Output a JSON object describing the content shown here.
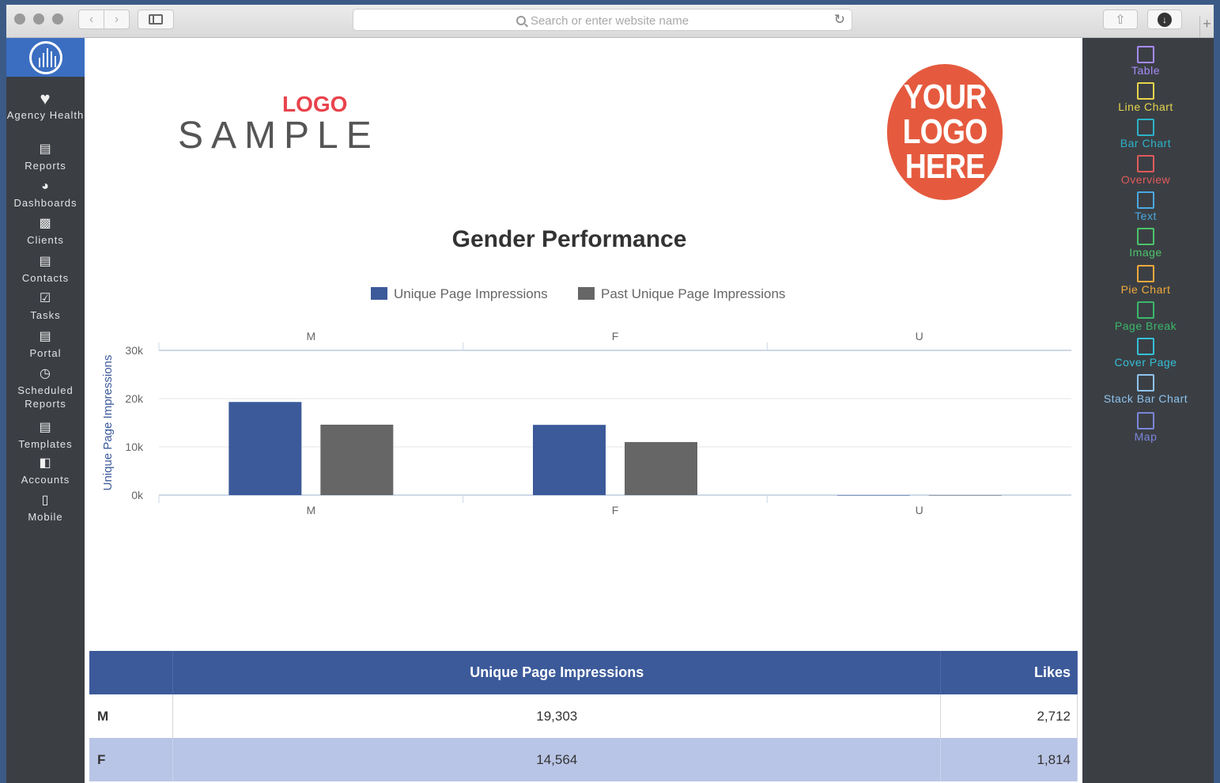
{
  "browser": {
    "url_placeholder": "Search or enter website name"
  },
  "left_nav": {
    "items": [
      {
        "label": "Agency Health",
        "icon": "heart-icon"
      },
      {
        "label": "Reports",
        "icon": "reports-icon"
      },
      {
        "label": "Dashboards",
        "icon": "pie-icon"
      },
      {
        "label": "Clients",
        "icon": "briefcase-icon"
      },
      {
        "label": "Contacts",
        "icon": "contacts-icon"
      },
      {
        "label": "Tasks",
        "icon": "checkbox-icon"
      },
      {
        "label": "Portal",
        "icon": "portal-icon"
      },
      {
        "label": "Scheduled Reports",
        "icon": "clock-icon"
      },
      {
        "label": "Templates",
        "icon": "templates-icon"
      },
      {
        "label": "Accounts",
        "icon": "accounts-icon"
      },
      {
        "label": "Mobile",
        "icon": "mobile-icon"
      }
    ]
  },
  "right_tools": {
    "items": [
      {
        "label": "Table",
        "color": "#a78bfa",
        "icon": "table-icon"
      },
      {
        "label": "Line Chart",
        "color": "#e8d44d",
        "icon": "line-chart-icon"
      },
      {
        "label": "Bar Chart",
        "color": "#2bb3c9",
        "icon": "bar-chart-icon"
      },
      {
        "label": "Overview",
        "color": "#e05a5a",
        "icon": "overview-icon"
      },
      {
        "label": "Text",
        "color": "#4aa8e0",
        "icon": "text-icon"
      },
      {
        "label": "Image",
        "color": "#4cc46b",
        "icon": "image-icon"
      },
      {
        "label": "Pie Chart",
        "color": "#f2a93b",
        "icon": "pie-chart-icon"
      },
      {
        "label": "Page Break",
        "color": "#3bb86a",
        "icon": "page-break-icon"
      },
      {
        "label": "Cover Page",
        "color": "#35c0d8",
        "icon": "cover-page-icon"
      },
      {
        "label": "Stack Bar Chart",
        "color": "#8fc3ee",
        "icon": "stack-bar-chart-icon"
      },
      {
        "label": "Map",
        "color": "#7b86d9",
        "icon": "map-icon"
      }
    ]
  },
  "report": {
    "logo_small": "LOGO",
    "logo_big": "SAMPLE",
    "your_logo_lines": [
      "YOUR",
      "LOGO",
      "HERE"
    ]
  },
  "chart_data": {
    "type": "bar",
    "title": "Gender Performance",
    "categories": [
      "M",
      "F",
      "U"
    ],
    "series": [
      {
        "name": "Unique Page Impressions",
        "values": [
          19303,
          14564,
          0
        ],
        "color": "#3c5a9a"
      },
      {
        "name": "Past Unique Page Impressions",
        "values": [
          14600,
          11000,
          0
        ],
        "color": "#666666"
      }
    ],
    "ylabel": "Unique Page Impressions",
    "yticks": [
      "0k",
      "10k",
      "20k",
      "30k"
    ],
    "ylim": [
      0,
      30000
    ],
    "grid": true,
    "legend_position": "top"
  },
  "table": {
    "headers": [
      "",
      "Unique Page Impressions",
      "Likes"
    ],
    "rows": [
      {
        "label": "M",
        "impressions": "19,303",
        "likes": "2,712"
      },
      {
        "label": "F",
        "impressions": "14,564",
        "likes": "1,814"
      }
    ]
  }
}
